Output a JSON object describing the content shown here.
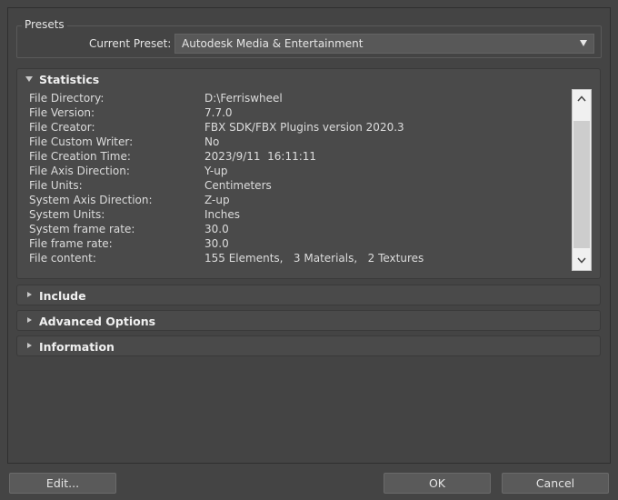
{
  "presets": {
    "title": "Presets",
    "current_label": "Current Preset:",
    "current_value": "Autodesk Media & Entertainment"
  },
  "rollouts": {
    "statistics": "Statistics",
    "include": "Include",
    "advanced": "Advanced Options",
    "information": "Information"
  },
  "stats": [
    {
      "key": "File Directory:",
      "value": "D:\\Ferriswheel"
    },
    {
      "key": "File Version:",
      "value": "7.7.0"
    },
    {
      "key": "File Creator:",
      "value": "FBX SDK/FBX Plugins version 2020.3"
    },
    {
      "key": "File Custom Writer:",
      "value": "No"
    },
    {
      "key": "File Creation Time:",
      "value": "2023/9/11  16:11:11"
    },
    {
      "key": "File Axis Direction:",
      "value": "Y-up"
    },
    {
      "key": "File Units:",
      "value": "Centimeters"
    },
    {
      "key": "System Axis Direction:",
      "value": "Z-up"
    },
    {
      "key": "System Units:",
      "value": "Inches"
    },
    {
      "key": "System frame rate:",
      "value": "30.0"
    },
    {
      "key": "File frame rate:",
      "value": "30.0"
    },
    {
      "key": "File content:",
      "value": "155 Elements,   3 Materials,   2 Textures"
    }
  ],
  "buttons": {
    "edit": "Edit...",
    "ok": "OK",
    "cancel": "Cancel"
  }
}
